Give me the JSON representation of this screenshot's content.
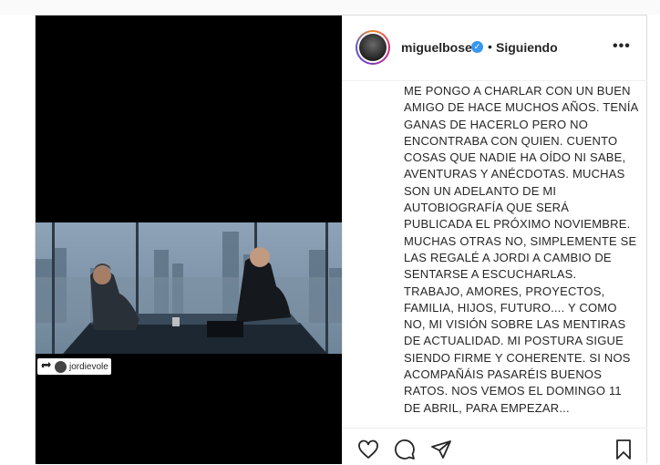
{
  "post": {
    "author": {
      "username": "miguelbose",
      "verified_icon": "verified-badge-icon",
      "separator": "•",
      "follow_status": "Siguiendo",
      "more_icon": "ellipsis-icon",
      "more_label": "•••"
    },
    "media": {
      "repost_icon": "repost-icon",
      "repost_account": "jordievole"
    },
    "caption": "ME PONGO A CHARLAR CON UN BUEN AMIGO DE HACE MUCHOS AÑOS. TENÍA GANAS DE HACERLO PERO NO ENCONTRABA CON QUIEN. CUENTO COSAS QUE NADIE HA OÍDO NI SABE, AVENTURAS Y ANÉCDOTAS. MUCHAS SON UN ADELANTO DE MI AUTOBIOGRAFÍA QUE SERÁ PUBLICADA EL PRÓXIMO NOVIEMBRE. MUCHAS OTRAS NO, SIMPLEMENTE SE LAS REGALÉ A JORDI A CAMBIO DE SENTARSE A ESCUCHARLAS. TRABAJO, AMORES, PROYECTOS, FAMILIA, HIJOS, FUTURO.... Y COMO NO, MI VISIÓN SOBRE LAS MENTIRAS DE ACTUALIDAD. MI POSTURA SIGUE SIENDO FIRME Y COHERENTE. SI NOS ACOMPAÑÁIS PASARÉIS BUENOS RATOS. NOS VEMOS EL DOMINGO 11 DE ABRIL, PARA EMPEZAR...",
    "actions": [
      "heart-icon",
      "comment-icon",
      "share-icon",
      "bookmark-icon"
    ]
  },
  "colors": {
    "verified": "#3897f0",
    "text": "#262626",
    "border": "#dbdbdb"
  }
}
